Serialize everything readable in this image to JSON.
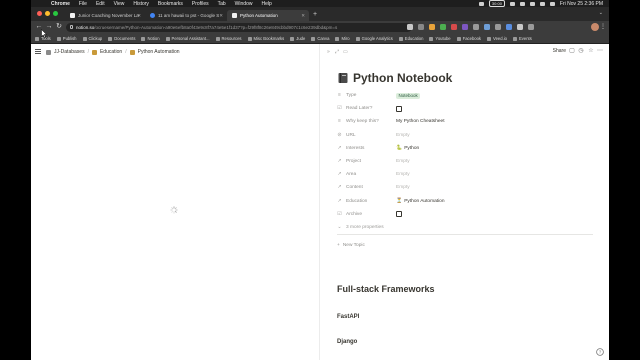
{
  "menubar": {
    "app": "Chrome",
    "items": [
      "File",
      "Edit",
      "View",
      "History",
      "Bookmarks",
      "Profiles",
      "Tab",
      "Window",
      "Help"
    ],
    "recording_time": "30:00",
    "datetime": "Fri Nov 25  2:36 PM"
  },
  "tabs": [
    {
      "title": "Junior Coaching November La",
      "favicon_color": "#f2f2f2"
    },
    {
      "title": "11 am hawaii to pst - Google S",
      "favicon_color": "#4285f4"
    },
    {
      "title": "Python Automation",
      "favicon_color": "#f2f2f2"
    }
  ],
  "newtab_label": "+",
  "address": {
    "host": "notion.so",
    "path": "/ocruesername/Python-Automation-a90e6efb8a0f43e9c8f7a74e5e1f1d37?p=f29f8f8c26e849cbbd907c1c6e239dbd&pm=s"
  },
  "toolbar_colors": [
    "#c8c8c8",
    "#888888",
    "#e8a33a",
    "#4caf50",
    "#d64b4b",
    "#7e57c2",
    "#9a9a9a",
    "#6e9fd8",
    "#9a9a9a",
    "#5a8ee0",
    "#c8c8c8",
    "#9a9a9a"
  ],
  "bookmarks": [
    "Tools",
    "Publish",
    "Clickup",
    "Documents",
    "Notion",
    "Personal Assistant...",
    "Resources",
    "Misc Bookmarks",
    "Jude",
    "Canva",
    "Miro",
    "Google Analytics",
    "Education",
    "Youtube",
    "Facebook",
    "Veed.io",
    "Events"
  ],
  "breadcrumb": [
    "JJ-Databases",
    "Education",
    "Python Automation"
  ],
  "peek": {
    "share_label": "Share",
    "title": "Python Notebook",
    "properties": [
      {
        "icon": "≡",
        "name": "Type",
        "value": "Notebook",
        "kind": "pill"
      },
      {
        "icon": "☑",
        "name": "Read Later?",
        "value": "",
        "kind": "checkbox"
      },
      {
        "icon": "≡",
        "name": "Why keep this?",
        "value": "My Python Cheatsheet",
        "kind": "text"
      },
      {
        "icon": "⊘",
        "name": "URL",
        "value": "Empty",
        "kind": "empty"
      },
      {
        "icon": "↗",
        "name": "Interests",
        "value": "Python",
        "kind": "emoji",
        "emoji": "🐍"
      },
      {
        "icon": "↗",
        "name": "Project",
        "value": "Empty",
        "kind": "empty"
      },
      {
        "icon": "↗",
        "name": "Area",
        "value": "Empty",
        "kind": "empty"
      },
      {
        "icon": "↗",
        "name": "Content",
        "value": "Empty",
        "kind": "empty"
      },
      {
        "icon": "↗",
        "name": "Education",
        "value": "Python Automation",
        "kind": "emoji",
        "emoji": "⏳"
      },
      {
        "icon": "☑",
        "name": "Archive",
        "value": "",
        "kind": "checkbox"
      }
    ],
    "more_properties": "3 more properties",
    "new_topic": "New Topic",
    "heading": "Full-stack Frameworks",
    "subheadings": [
      "FastAPI",
      "Django"
    ]
  }
}
